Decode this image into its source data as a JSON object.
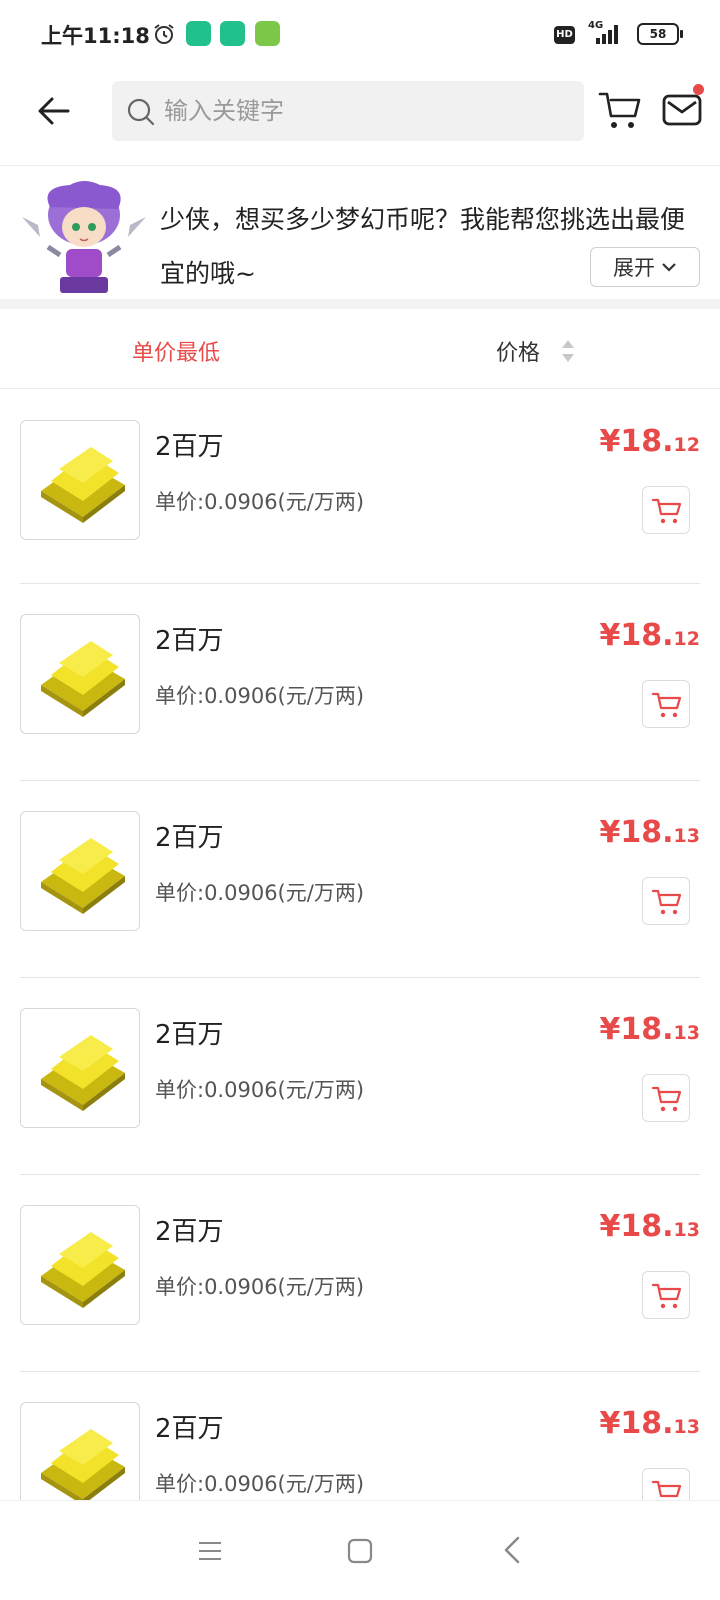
{
  "status_bar": {
    "time": "上午11:18",
    "network_badge": "HD",
    "network_type": "4G",
    "battery": "58"
  },
  "header": {
    "search_placeholder": "输入关键字"
  },
  "banner": {
    "message": "少侠，想买多少梦幻币呢？我能帮您挑选出最便宜的哦~",
    "expand_label": "展开"
  },
  "sort": {
    "lowest_unit_price": "单价最低",
    "price": "价格"
  },
  "items": [
    {
      "title": "2百万",
      "unit_price": "单价:0.0906(元/万两)",
      "price_main": "¥18.",
      "price_dec": "12"
    },
    {
      "title": "2百万",
      "unit_price": "单价:0.0906(元/万两)",
      "price_main": "¥18.",
      "price_dec": "12"
    },
    {
      "title": "2百万",
      "unit_price": "单价:0.0906(元/万两)",
      "price_main": "¥18.",
      "price_dec": "13"
    },
    {
      "title": "2百万",
      "unit_price": "单价:0.0906(元/万两)",
      "price_main": "¥18.",
      "price_dec": "13"
    },
    {
      "title": "2百万",
      "unit_price": "单价:0.0906(元/万两)",
      "price_main": "¥18.",
      "price_dec": "13"
    },
    {
      "title": "2百万",
      "unit_price": "单价:0.0906(元/万两)",
      "price_main": "¥18.",
      "price_dec": "13"
    }
  ],
  "colors": {
    "accent": "#e84a4a",
    "gold": "#e8d31a"
  }
}
